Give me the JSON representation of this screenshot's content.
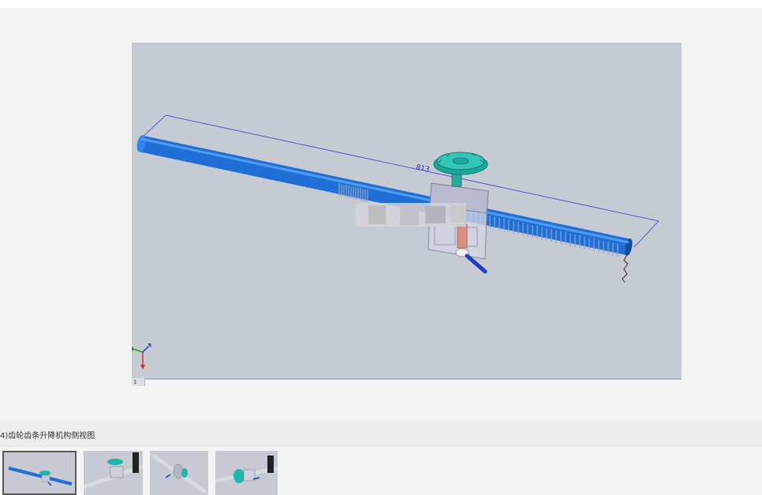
{
  "viewer": {
    "dimension_label": "813",
    "page_indicator": "1",
    "background_color": "#c6cad3",
    "rod_color": "#1f6fd6",
    "handwheel_color": "#1fb5a8"
  },
  "caption": {
    "text": "4)齿轮齿条升降机构侧视图"
  },
  "thumbnails": [
    {
      "name": "thumbnail-1",
      "selected": true
    },
    {
      "name": "thumbnail-2",
      "selected": false
    },
    {
      "name": "thumbnail-3",
      "selected": false
    },
    {
      "name": "thumbnail-4",
      "selected": false
    }
  ]
}
